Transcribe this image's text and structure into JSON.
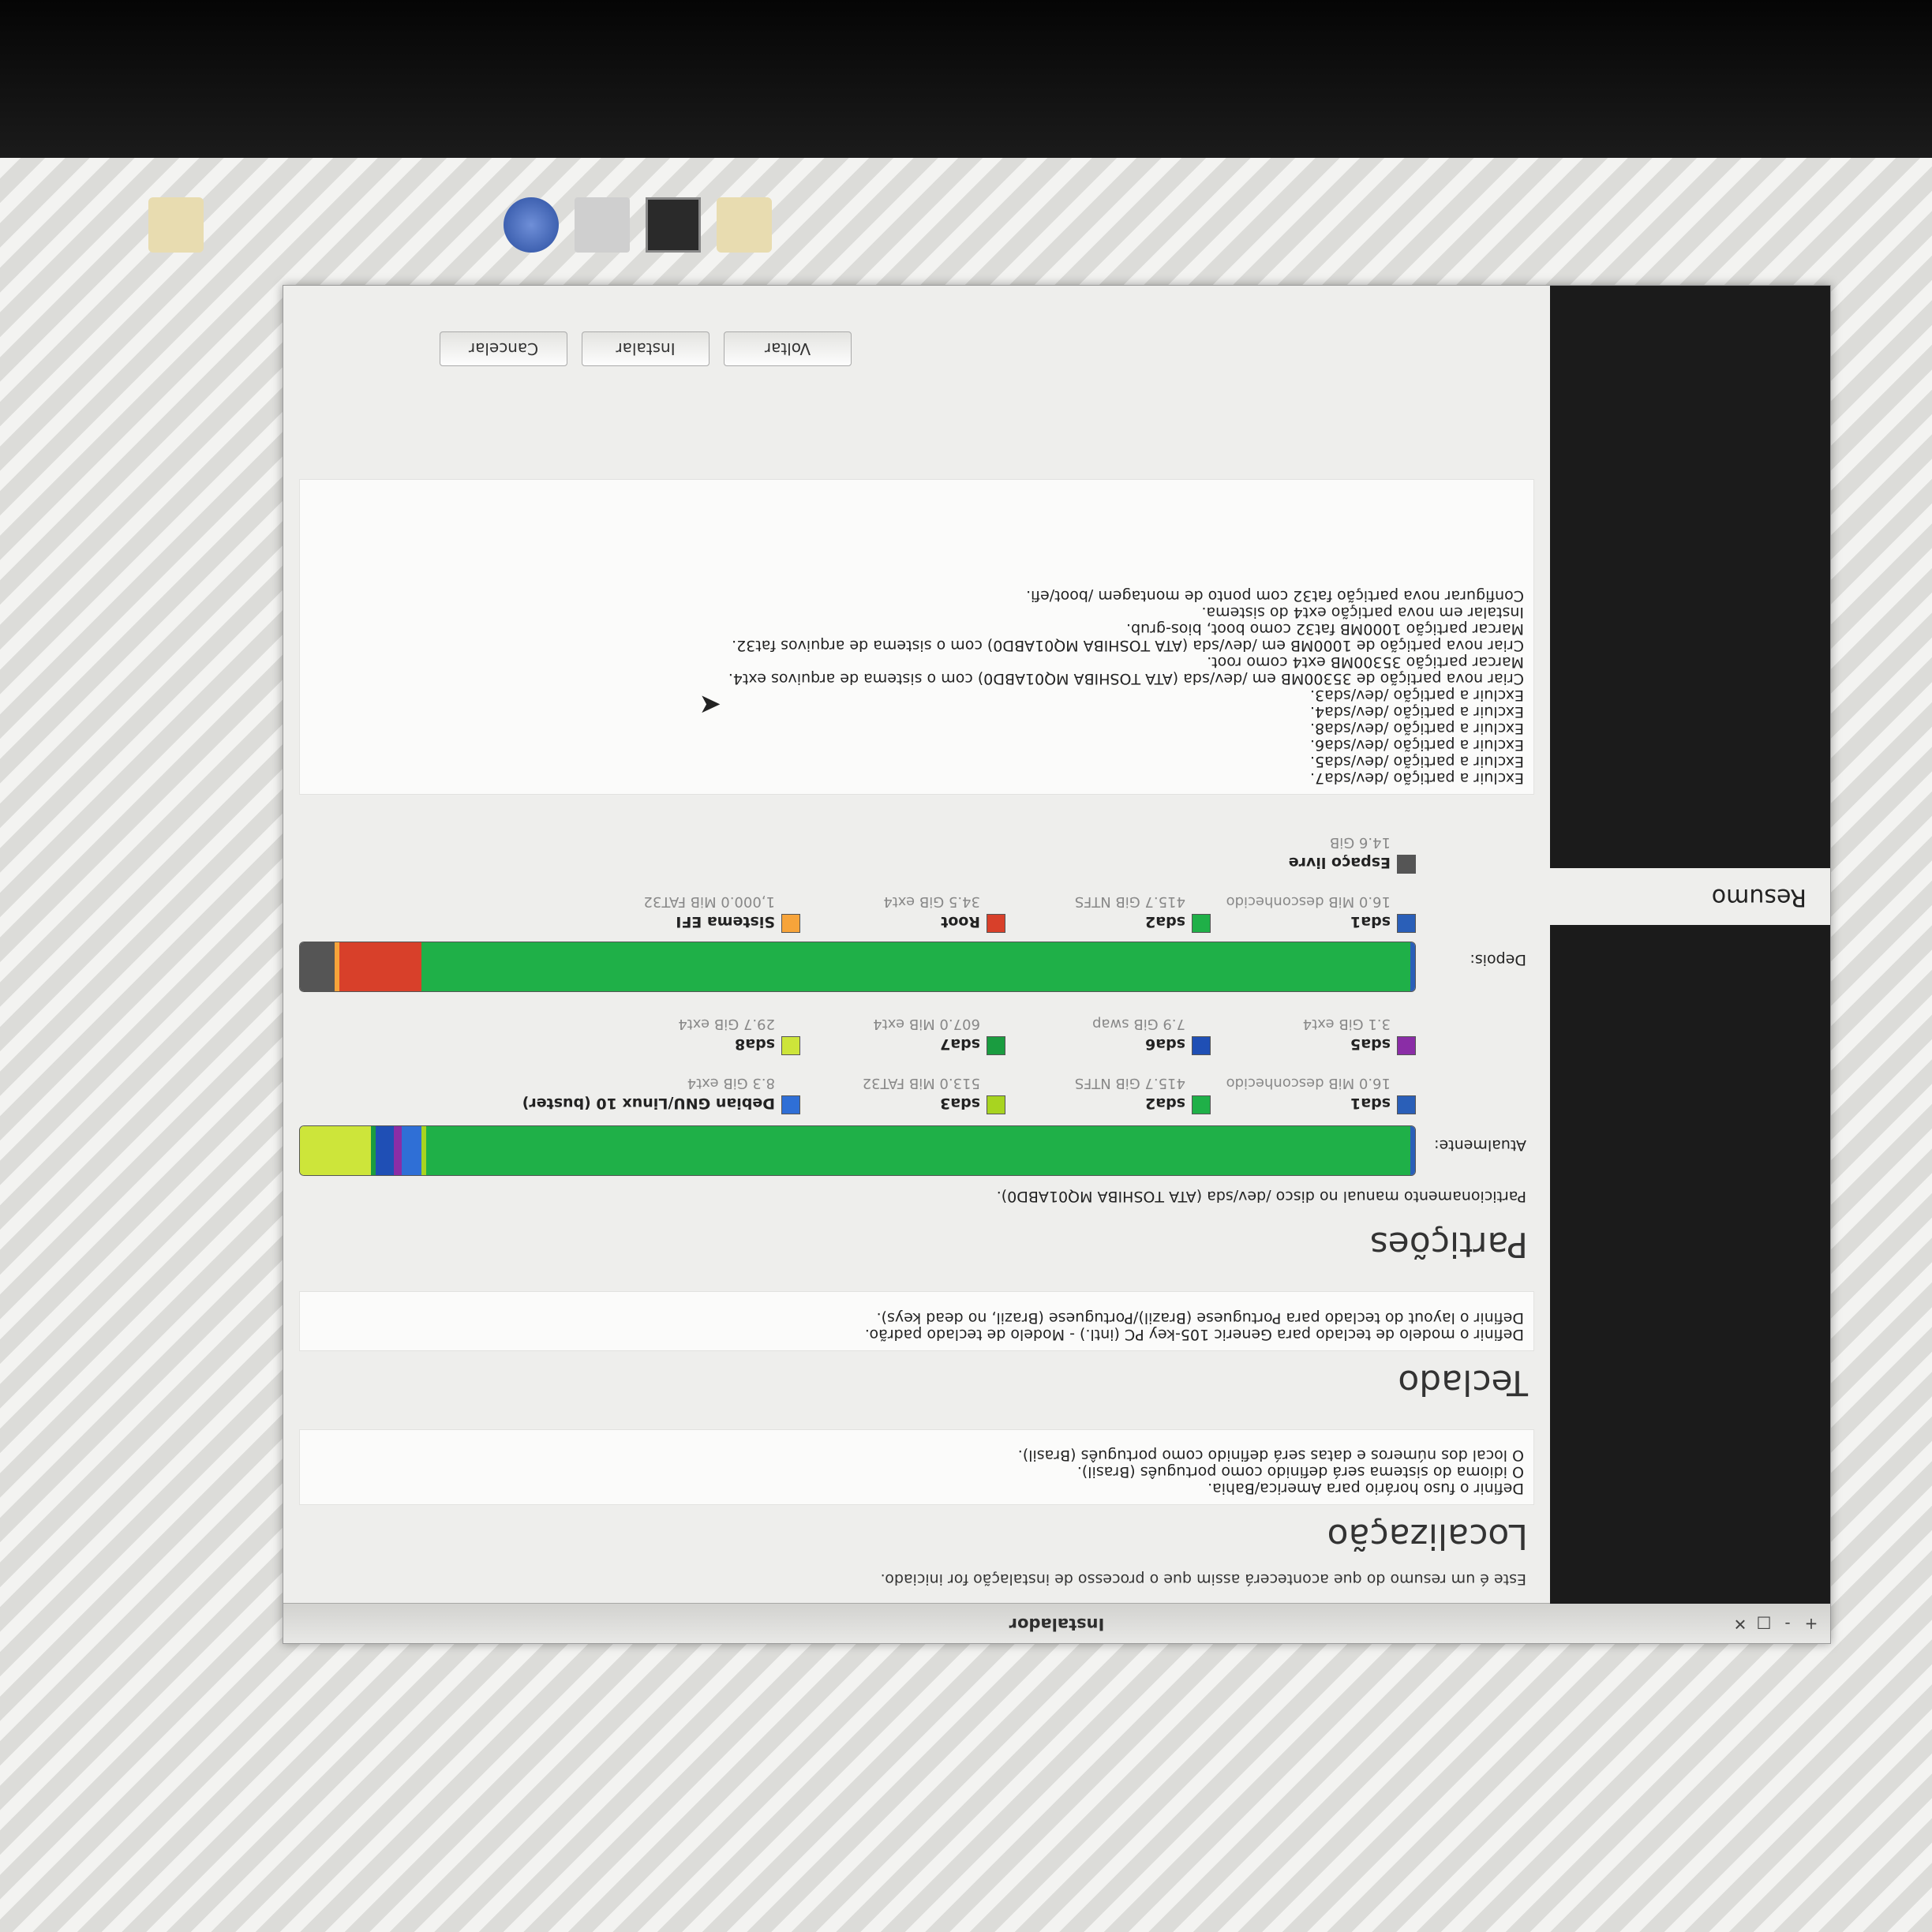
{
  "window": {
    "title": "Instalador",
    "controls": [
      "+",
      "-",
      "□",
      "✕"
    ]
  },
  "sidebar": {
    "active_item": "Resumo"
  },
  "intro": "Este é um resumo do que acontecerá assim que o processo de instalação for iniciado.",
  "sections": {
    "localizacao": {
      "title": "Localização",
      "lines": [
        "Definir o fuso horário para America/Bahia.",
        "O idioma do sistema será definido como português (Brasil).",
        "O local dos números e datas será definido como português (Brasil)."
      ]
    },
    "teclado": {
      "title": "Teclado",
      "lines": [
        "Definir o modelo de teclado para Generic 105-key PC (intl.) - Modelo de teclado padrão.",
        "Definir o layout do teclado para Portuguese (Brazil)/Portuguese (Brazil, no dead keys)."
      ]
    },
    "particoes": {
      "title": "Partições",
      "subtitle": "Particionamento manual no disco /dev/sda (ATA TOSHIBA MQ01ABD0).",
      "atualmente_label": "Atualmente:",
      "depois_label": "Depois:",
      "before": [
        {
          "name": "sda1",
          "size": "16.0 MiB",
          "fs": "desconhecido",
          "color": "#2a5fb8",
          "share": 0.001
        },
        {
          "name": "sda2",
          "size": "415.7 GiB",
          "fs": "NTFS",
          "color": "#1fb048",
          "share": 0.891
        },
        {
          "name": "sda3",
          "size": "513.0 MiB",
          "fs": "FAT32",
          "color": "#a8d420",
          "share": 0.004
        },
        {
          "name": "Debian GNU/Linux 10 (buster)",
          "size": "8.3 GiB",
          "fs": "ext4",
          "color": "#2f6fd6",
          "share": 0.018
        },
        {
          "name": "sda5",
          "size": "3.1 GiB",
          "fs": "ext4",
          "color": "#8a2da6",
          "share": 0.007
        },
        {
          "name": "sda6",
          "size": "7.9 GiB",
          "fs": "swap",
          "color": "#1f4fb5",
          "share": 0.017
        },
        {
          "name": "sda7",
          "size": "607.0 MiB",
          "fs": "ext4",
          "color": "#1a9c40",
          "share": 0.001
        },
        {
          "name": "sda8",
          "size": "29.7 GiB",
          "fs": "ext4",
          "color": "#cde53a",
          "share": 0.064
        }
      ],
      "after": [
        {
          "name": "sda1",
          "size": "16.0 MiB",
          "fs": "desconhecido",
          "color": "#2a5fb8",
          "share": 0.004
        },
        {
          "name": "sda2",
          "size": "415.7 GiB",
          "fs": "NTFS",
          "color": "#1fb048",
          "share": 0.891
        },
        {
          "name": "Root",
          "size": "34.5 GiB",
          "fs": "ext4",
          "color": "#d8402a",
          "share": 0.074
        },
        {
          "name": "Sistema EFI",
          "size": "1,000.0 MiB",
          "fs": "FAT32",
          "color": "#f7a43a",
          "share": 0.002
        },
        {
          "name": "Espaço livre",
          "size": "14.6 GiB",
          "fs": "",
          "color": "#555555",
          "share": 0.031
        }
      ],
      "actions": [
        "Excluir a partição /dev/sda7.",
        "Excluir a partição /dev/sda5.",
        "Excluir a partição /dev/sda6.",
        "Excluir a partição /dev/sda8.",
        "Excluir a partição /dev/sda4.",
        "Excluir a partição /dev/sda3.",
        "Criar nova partição de 35300MB em /dev/sda (ATA TOSHIBA MQ01ABD0) com o sistema de arquivos ext4.",
        "Marcar partição 35300MB ext4 como root.",
        "Criar nova partição de 1000MB em /dev/sda (ATA TOSHIBA MQ01ABD0) com o sistema de arquivos fat32.",
        "Marcar partição 1000MB fat32 como boot, bios-grub.",
        "Instalar em nova partição ext4 do sistema.",
        "Configurar nova partição fat32 com ponto de montagem /boot/efi."
      ]
    }
  },
  "buttons": {
    "back": "Voltar",
    "install": "Instalar",
    "cancel": "Cancelar"
  }
}
